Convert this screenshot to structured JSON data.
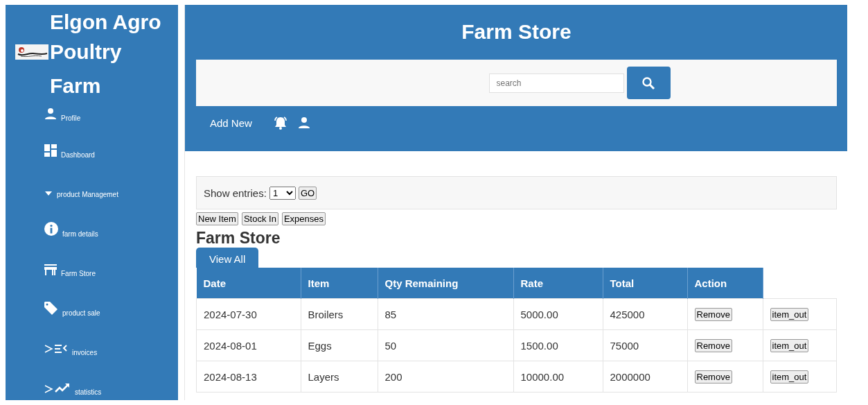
{
  "sidebar": {
    "brand": [
      "Elgon Agro",
      "Poultry",
      "Farm"
    ],
    "items": [
      {
        "label": "Profile"
      },
      {
        "label": "Dashboard"
      },
      {
        "label": "product Managemet"
      },
      {
        "label": "farm details"
      },
      {
        "label": "Farm Store"
      },
      {
        "label": "product sale"
      },
      {
        "label": "invoices"
      },
      {
        "label": "statistics"
      }
    ]
  },
  "header": {
    "title": "Farm Store",
    "search": {
      "placeholder": "search"
    },
    "add_new": "Add New"
  },
  "filter": {
    "label": "Show entries:",
    "value": "1",
    "go": "GO"
  },
  "actions": [
    "New Item",
    "Stock In",
    "Expenses"
  ],
  "section_title": "Farm Store",
  "tab": {
    "label": "View All",
    "selected": true
  },
  "table": {
    "columns": [
      "Date",
      "Item",
      "Qty Remaining",
      "Rate",
      "Total",
      "Action"
    ],
    "rows": [
      {
        "cells": [
          "2024-07-30",
          "Broilers",
          "85",
          "5000.00",
          "425000"
        ],
        "buttons": [
          "Remove",
          "item_out"
        ]
      },
      {
        "cells": [
          "2024-08-01",
          "Eggs",
          "50",
          "1500.00",
          "75000"
        ],
        "buttons": [
          "Remove",
          "item_out"
        ]
      },
      {
        "cells": [
          "2024-08-13",
          "Layers",
          "200",
          "10000.00",
          "2000000"
        ],
        "buttons": [
          "Remove",
          "item_out"
        ]
      }
    ]
  }
}
